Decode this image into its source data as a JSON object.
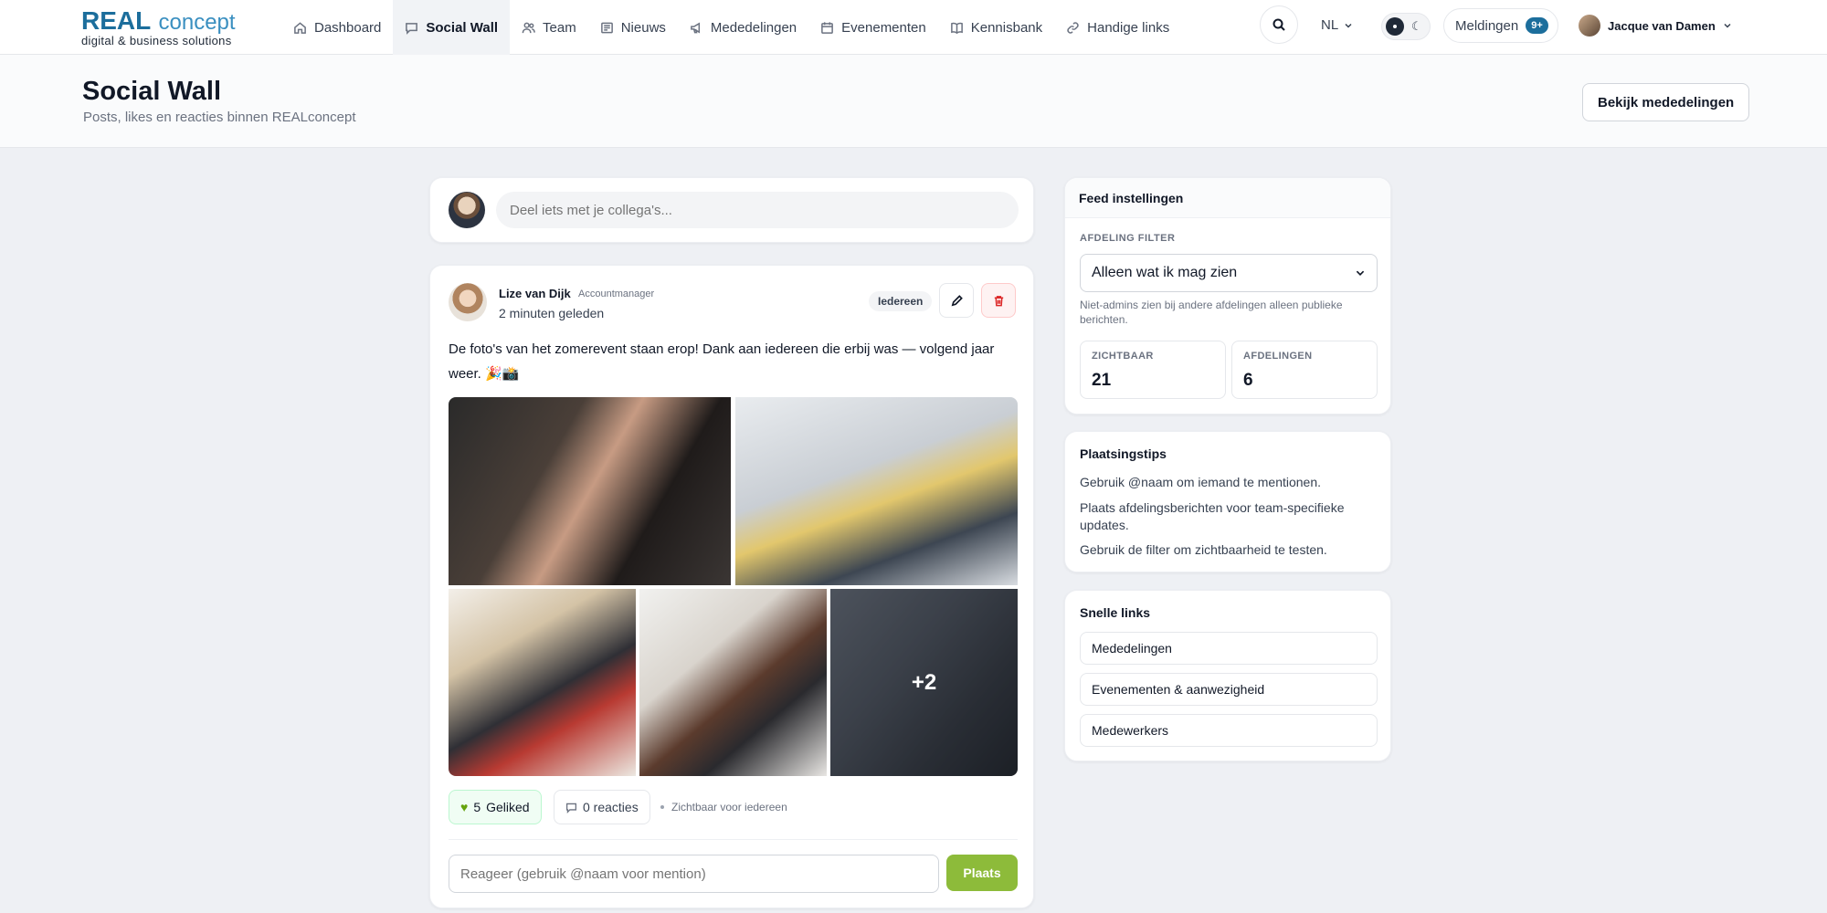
{
  "brand": {
    "name_bold": "REAL",
    "name_light": "concept",
    "tagline": "digital & business solutions"
  },
  "nav": [
    {
      "label": "Dashboard",
      "icon": "home-icon",
      "active": false
    },
    {
      "label": "Social Wall",
      "icon": "chat-icon",
      "active": true
    },
    {
      "label": "Team",
      "icon": "users-icon",
      "active": false
    },
    {
      "label": "Nieuws",
      "icon": "newspaper-icon",
      "active": false
    },
    {
      "label": "Mededelingen",
      "icon": "megaphone-icon",
      "active": false
    },
    {
      "label": "Evenementen",
      "icon": "calendar-icon",
      "active": false
    },
    {
      "label": "Kennisbank",
      "icon": "book-icon",
      "active": false
    },
    {
      "label": "Handige links",
      "icon": "link-icon",
      "active": false
    }
  ],
  "topbar": {
    "language": "NL",
    "notifications_label": "Meldingen",
    "notifications_count": "9+",
    "user_name": "Jacque van Damen"
  },
  "page": {
    "title": "Social Wall",
    "subtitle": "Posts, likes en reacties binnen REALconcept",
    "header_button": "Bekijk mededelingen"
  },
  "composer": {
    "placeholder": "Deel iets met je collega's..."
  },
  "post": {
    "author": "Lize van Dijk",
    "role": "Accountmanager",
    "time": "2 minuten geleden",
    "audience": "Iedereen",
    "text": "De foto's van het zomerevent staan erop! Dank aan iedereen die erbij was — volgend jaar weer. 🎉📸",
    "extra_images": "+2",
    "likes_count": "5",
    "likes_label": "Geliked",
    "reactions_label": "0 reacties",
    "visibility": "Zichtbaar voor iedereen",
    "reply_placeholder": "Reageer (gebruik @naam voor mention)",
    "reply_button": "Plaats"
  },
  "feed_settings": {
    "title": "Feed instellingen",
    "filter_label": "AFDELING FILTER",
    "filter_value": "Alleen wat ik mag zien",
    "note": "Niet-admins zien bij andere afdelingen alleen publieke berichten.",
    "visible_label": "ZICHTBAAR",
    "visible_value": "21",
    "departments_label": "AFDELINGEN",
    "departments_value": "6"
  },
  "tips": {
    "title": "Plaatsingstips",
    "items": [
      "Gebruik @naam om iemand te mentionen.",
      "Plaats afdelingsberichten voor team-specifieke updates.",
      "Gebruik de filter om zichtbaarheid te testen."
    ]
  },
  "quick_links": {
    "title": "Snelle links",
    "items": [
      "Mededelingen",
      "Evenementen & aanwezigheid",
      "Medewerkers"
    ]
  },
  "colors": {
    "brand_blue": "#1c6e9c",
    "accent_green": "#8dbb3a",
    "delete_red": "#dc2626"
  }
}
